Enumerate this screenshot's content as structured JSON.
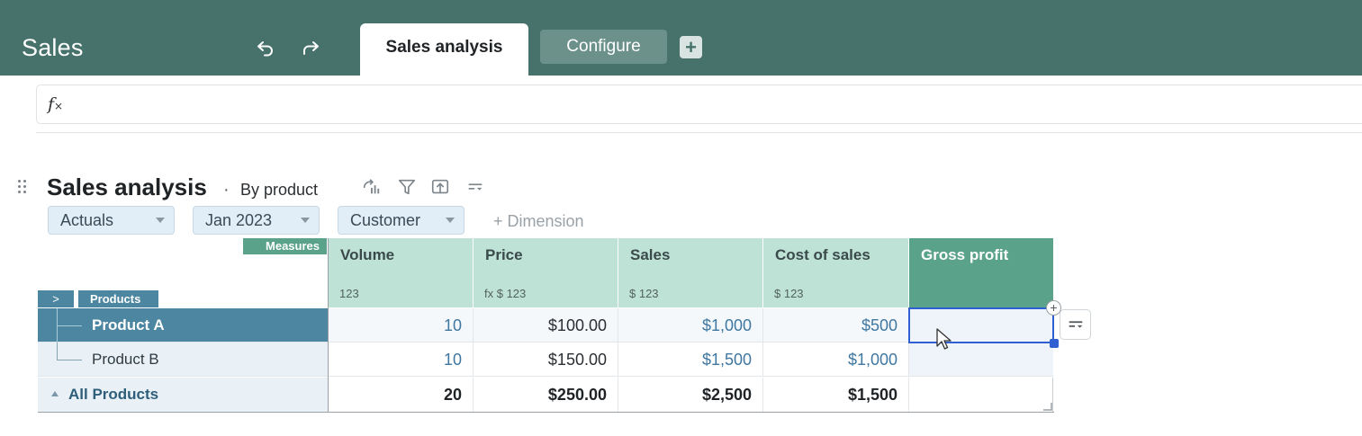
{
  "app": {
    "title": "Sales",
    "undo_icon": "undo-icon",
    "redo_icon": "redo-icon",
    "tabs": [
      {
        "label": "Sales analysis",
        "active": true
      },
      {
        "label": "Configure",
        "active": false
      }
    ],
    "add_tab_icon": "plus-icon",
    "add_tab_glyph": "+",
    "brand_color": "#46726b"
  },
  "formula_bar": {
    "icon": "fx-icon",
    "value": ""
  },
  "block": {
    "title": "Sales analysis",
    "separator": "·",
    "view": "By product",
    "toolbar_icons": [
      "pivot-icon",
      "filter-icon",
      "export-icon",
      "format-icon"
    ],
    "pills": [
      {
        "label": "Actuals"
      },
      {
        "label": "Jan 2023"
      },
      {
        "label": "Customer"
      }
    ],
    "add_dimension": "+ Dimension"
  },
  "grid": {
    "measures_label": "Measures",
    "row_dimension_label": "Products",
    "expand_glyph": ">",
    "columns": [
      {
        "label": "Volume",
        "format": "123"
      },
      {
        "label": "Price",
        "format": "fx  $  123"
      },
      {
        "label": "Sales",
        "format": "$  123"
      },
      {
        "label": "Cost of sales",
        "format": "$  123"
      },
      {
        "label": "Gross profit",
        "format": ""
      }
    ],
    "rows": [
      {
        "label": "Product A",
        "selected": true,
        "values": [
          "10",
          "$100.00",
          "$1,000",
          "$500",
          ""
        ]
      },
      {
        "label": "Product B",
        "selected": false,
        "values": [
          "10",
          "$150.00",
          "$1,500",
          "$1,000",
          ""
        ]
      },
      {
        "label": "All Products",
        "total": true,
        "values": [
          "20",
          "$250.00",
          "$2,500",
          "$1,500",
          ""
        ]
      }
    ],
    "selected_cell": {
      "row": "Product A",
      "column": "Gross profit"
    },
    "add_glyph": "+",
    "colors": {
      "header_bg": "#bfe2d6",
      "active_header_bg": "#5aa28a",
      "row_selected_bg": "#4d86a0",
      "input_text": "#3f77a0",
      "selection": "#2f5fd1"
    }
  }
}
